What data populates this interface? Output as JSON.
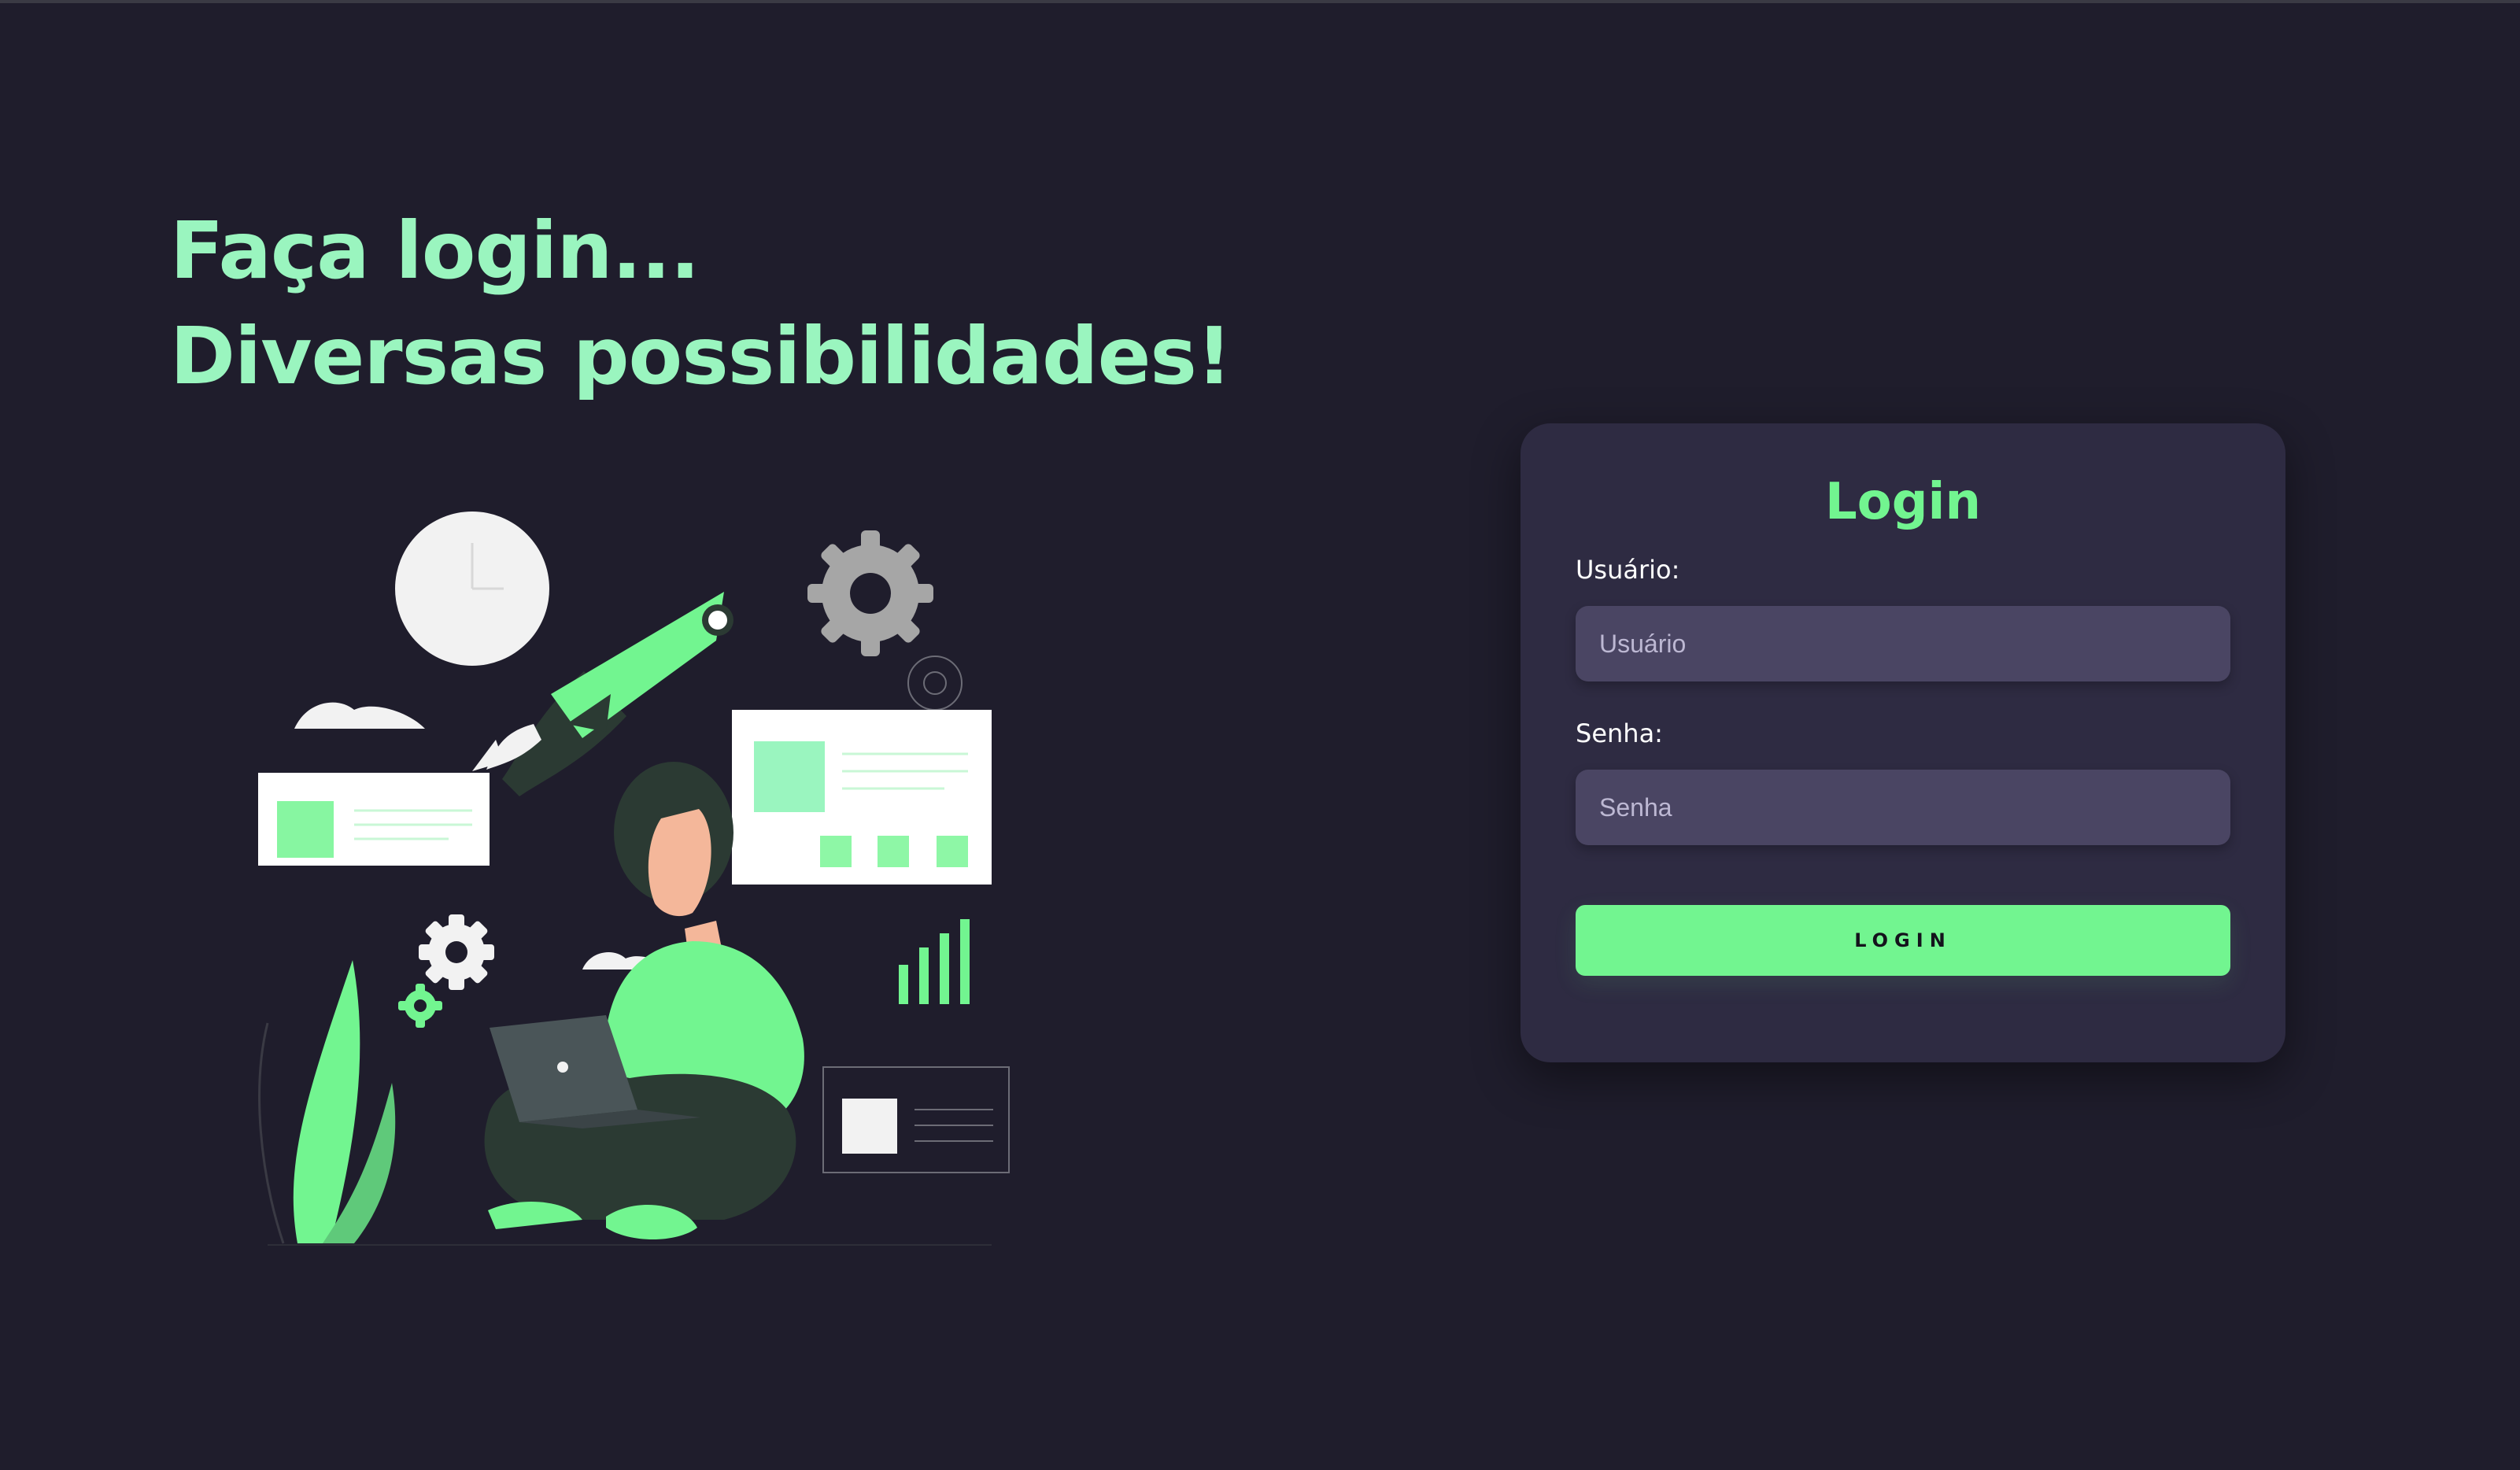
{
  "headline": {
    "line1": "Faça login...",
    "line2": "Diversas possibilidades!"
  },
  "login_card": {
    "title": "Login",
    "username_label": "Usuário:",
    "username_placeholder": "Usuário",
    "password_label": "Senha:",
    "password_placeholder": "Senha",
    "submit_label": "LOGIN"
  },
  "colors": {
    "background": "#1f1d2c",
    "card": "#2e2b42",
    "input": "#4a4563",
    "accent": "#72f590",
    "headline": "#9af5bf"
  },
  "icons": [
    "clock-icon",
    "rocket-icon",
    "gear-icon",
    "bar-chart-icon",
    "laptop-icon",
    "plant-icon"
  ]
}
